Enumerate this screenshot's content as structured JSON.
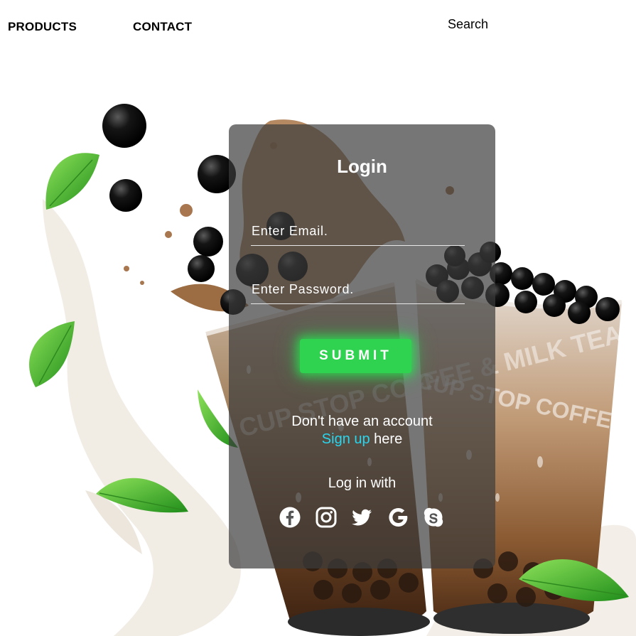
{
  "nav": {
    "products": "PRODUCTS",
    "contact": "CONTACT",
    "search": "Search"
  },
  "brand_watermark": "CUP STOP COFFEE & MILK TEA",
  "login": {
    "title": "Login",
    "email_placeholder": "Enter Email.",
    "password_placeholder": "Enter Password.",
    "submit_label": "SUBMIT",
    "no_account_text": "Don't have an account",
    "signup_link": "Sign up",
    "signup_suffix": " here",
    "login_with": "Log in with"
  },
  "socials": [
    {
      "icon": "facebook-icon"
    },
    {
      "icon": "instagram-icon"
    },
    {
      "icon": "twitter-icon"
    },
    {
      "icon": "google-icon"
    },
    {
      "icon": "skype-icon"
    }
  ],
  "colors": {
    "accent_green": "#2fd350",
    "link_cyan": "#29d6ee",
    "card_bg": "rgba(60,60,60,0.70)"
  }
}
